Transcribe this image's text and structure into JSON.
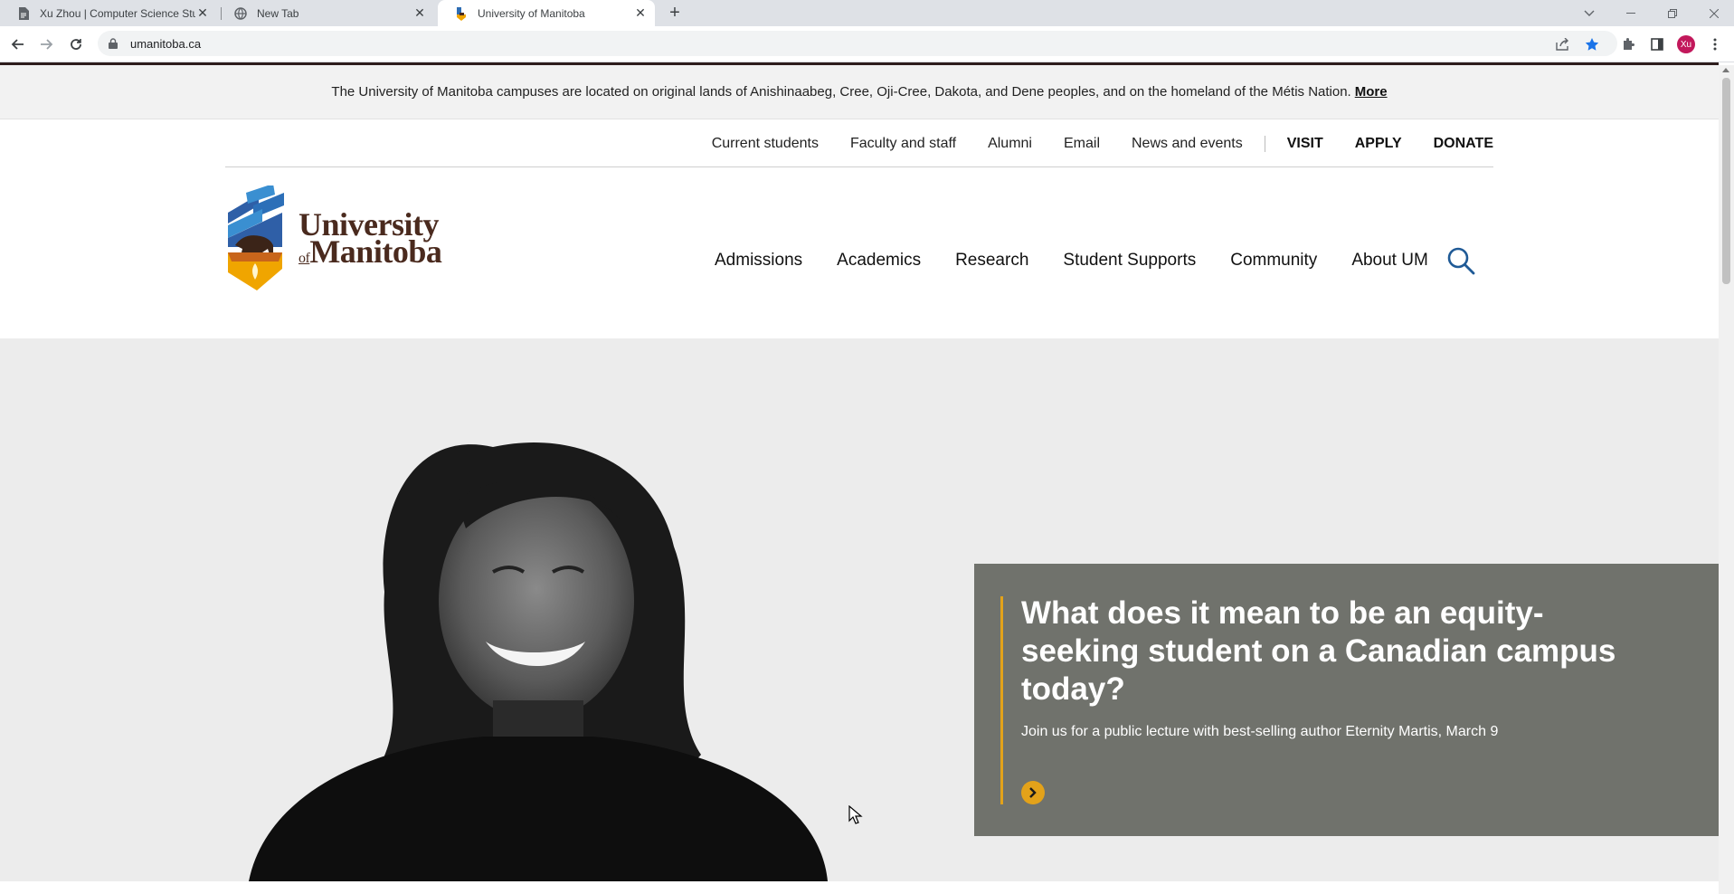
{
  "browser": {
    "tabs": [
      {
        "title": "Xu Zhou | Computer Science Stu",
        "close": "✕"
      },
      {
        "title": "New Tab",
        "close": "✕"
      },
      {
        "title": "University of Manitoba",
        "close": "✕"
      }
    ],
    "new_tab": "+",
    "url": "umanitoba.ca",
    "profile_initials": "Xu",
    "icons": [
      "back-icon",
      "forward-icon",
      "reload-icon",
      "lock-icon",
      "share-icon",
      "star-icon",
      "extensions-icon",
      "side-panel-icon",
      "menu-icon"
    ]
  },
  "land_ack": {
    "text": "The University of Manitoba campuses are located on original lands of Anishinaabeg, Cree, Oji-Cree, Dakota, and Dene peoples, and on the homeland of the Métis Nation.",
    "more": "More"
  },
  "utility_nav": {
    "items": [
      "Current students",
      "Faculty and staff",
      "Alumni",
      "Email",
      "News and events"
    ],
    "actions": [
      "VISIT",
      "APPLY",
      "DONATE"
    ]
  },
  "logo": {
    "line1": "University",
    "of": "of",
    "line2": "Manitoba"
  },
  "main_nav": {
    "items": [
      "Admissions",
      "Academics",
      "Research",
      "Student Supports",
      "Community",
      "About UM"
    ]
  },
  "hero": {
    "headline": "What does it mean to be an equity-seeking student on a Canadian campus today?",
    "description": "Join us for a public lecture with best-selling author Eternity Martis, March 9"
  },
  "colors": {
    "brand_brown": "#4a2a1e",
    "accent_gold": "#e3a21a",
    "callout_bg": "#70726c",
    "nav_blue": "#1f5a96"
  }
}
